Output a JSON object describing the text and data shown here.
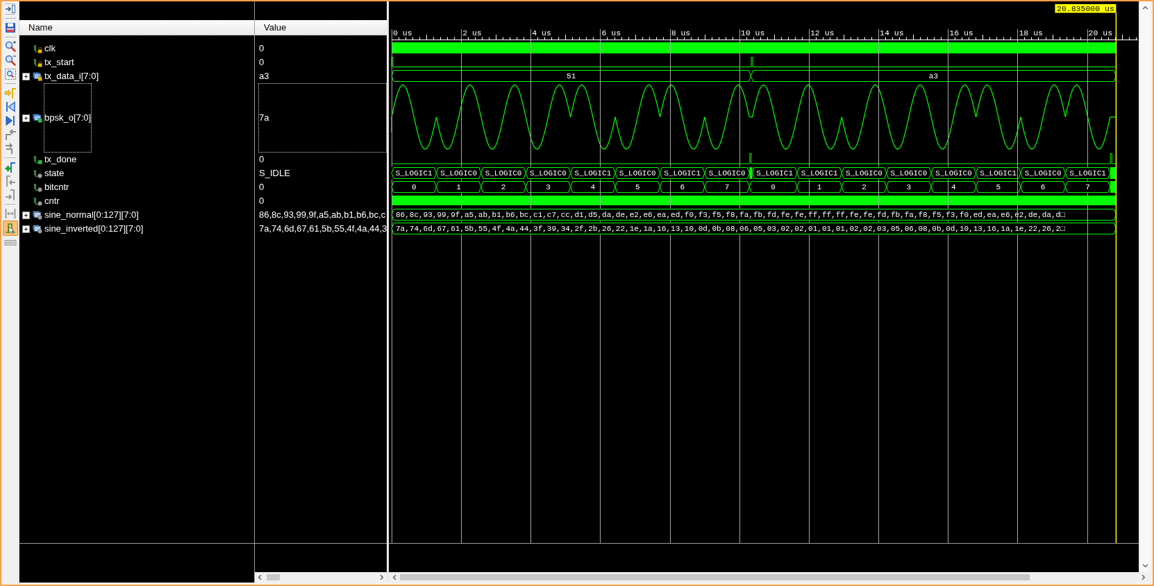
{
  "toolbar": [
    {
      "pressed": false
    },
    {
      "pressed": false
    },
    {
      "pressed": false
    },
    {
      "pressed": false
    },
    {
      "pressed": false
    },
    {
      "pressed": false
    },
    {
      "pressed": false
    },
    {
      "pressed": false
    },
    {
      "pressed": false
    },
    {
      "pressed": false
    },
    {
      "pressed": false
    },
    {
      "pressed": false
    },
    {
      "pressed": false
    },
    {
      "pressed": false
    },
    {
      "pressed": true
    },
    {
      "pressed": false
    }
  ],
  "columns": [
    "Name",
    "Value"
  ],
  "signals": [
    {
      "name": "clk",
      "value": "0",
      "kind": "input_bit",
      "expandable": false,
      "selected": false,
      "trace": {
        "kind": "clock"
      }
    },
    {
      "name": "tx_start",
      "value": "0",
      "kind": "input_bit",
      "expandable": false,
      "selected": false,
      "trace": {
        "kind": "start_pulse"
      }
    },
    {
      "name": "tx_data_i[7:0]",
      "value": "a3",
      "kind": "input_bus",
      "expandable": true,
      "selected": false,
      "trace": {
        "kind": "frame_bus",
        "segments": [
          "51",
          "a3"
        ]
      }
    },
    {
      "name": "bpsk_o[7:0]",
      "value": "7a",
      "kind": "output_bus",
      "expandable": true,
      "selected": true,
      "trace": {
        "kind": "analog",
        "symbols": [
          {
            "inverted": false
          },
          {
            "inverted": true
          },
          {
            "inverted": true
          },
          {
            "inverted": true
          },
          {
            "inverted": false
          },
          {
            "inverted": true
          },
          {
            "inverted": false
          },
          {
            "inverted": true
          },
          {
            "inverted": false
          },
          {
            "inverted": false
          },
          {
            "inverted": true
          },
          {
            "inverted": true
          },
          {
            "inverted": true
          },
          {
            "inverted": false
          },
          {
            "inverted": true
          },
          {
            "inverted": false
          }
        ]
      }
    },
    {
      "name": "tx_done",
      "value": "0",
      "kind": "output_bit",
      "expandable": false,
      "selected": false,
      "trace": {
        "kind": "done_pulse"
      }
    },
    {
      "name": "state",
      "value": "S_IDLE",
      "kind": "internal_bit",
      "expandable": false,
      "selected": false,
      "trace": {
        "kind": "bit_bus",
        "segments": [
          "S_LOGIC1",
          "S_LOGIC0",
          "S_LOGIC0",
          "S_LOGIC0",
          "S_LOGIC1",
          "S_LOGIC0",
          "S_LOGIC1",
          "S_LOGIC0",
          "S_LOGIC1",
          "S_LOGIC1",
          "S_LOGIC0",
          "S_LOGIC0",
          "S_LOGIC0",
          "S_LOGIC1",
          "S_LOGIC0",
          "S_LOGIC1"
        ]
      }
    },
    {
      "name": "bitcntr",
      "value": "0",
      "kind": "internal_bit",
      "expandable": false,
      "selected": false,
      "trace": {
        "kind": "counter_bus",
        "segments": [
          "0",
          "1",
          "2",
          "3",
          "4",
          "5",
          "6",
          "7",
          "0",
          "1",
          "2",
          "3",
          "4",
          "5",
          "6",
          "7"
        ]
      }
    },
    {
      "name": "cntr",
      "value": "0",
      "kind": "internal_bit",
      "expandable": false,
      "selected": false,
      "trace": {
        "kind": "toggle"
      }
    },
    {
      "name": "sine_normal[0:127][7:0]",
      "value": "86,8c,93,99,9f,a5,ab,b1,b6,bc,c",
      "kind": "internal_array",
      "expandable": true,
      "selected": false,
      "trace": {
        "kind": "array_bus",
        "segments": [
          "86,8c,93,99,9f,a5,ab,b1,b6,bc,c1,c7,cc,d1,d5,da,de,e2,e6,ea,ed,f0,f3,f5,f8,fa,fb,fd,fe,fe,ff,ff,ff,fe,fe,fd,fb,fa,f8,f5,f3,f0,ed,ea,e6,e2,de,da,d□"
        ]
      }
    },
    {
      "name": "sine_inverted[0:127][7:0]",
      "value": "7a,74,6d,67,61,5b,55,4f,4a,44,3",
      "kind": "internal_array",
      "expandable": true,
      "selected": false,
      "trace": {
        "kind": "array_bus",
        "segments": [
          "7a,74,6d,67,61,5b,55,4f,4a,44,3f,39,34,2f,2b,26,22,1e,1a,16,13,10,0d,0b,08,06,05,03,02,02,01,01,01,02,02,03,05,06,08,0b,0d,10,13,16,1a,1e,22,26,2□"
        ]
      }
    }
  ],
  "ruler": [
    "0 us",
    "2 us",
    "4 us",
    "6 us",
    "8 us",
    "10 us",
    "12 us",
    "14 us",
    "16 us",
    "18 us",
    "20 us"
  ],
  "cursor": {
    "label": "20.835000 us"
  }
}
